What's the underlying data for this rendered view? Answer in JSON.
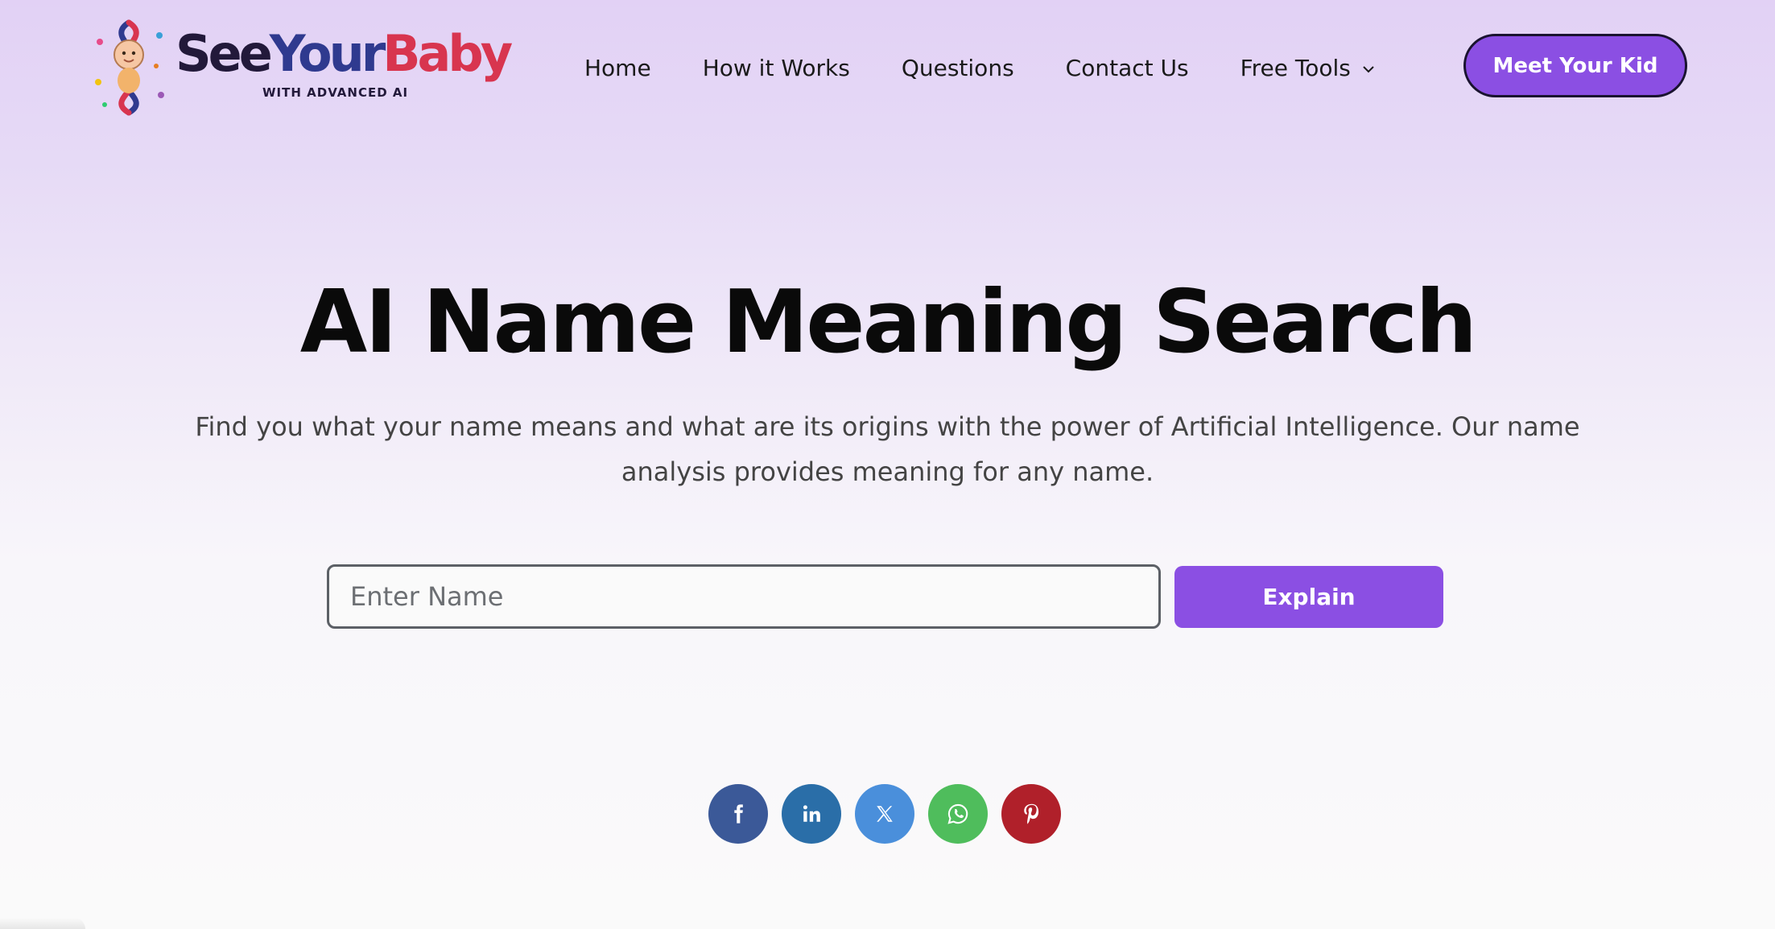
{
  "brand": {
    "word_see": "See",
    "word_your": "Your",
    "word_baby": "Baby",
    "tagline": "WITH ADVANCED AI"
  },
  "nav": {
    "items": [
      {
        "label": "Home"
      },
      {
        "label": "How it Works"
      },
      {
        "label": "Questions"
      },
      {
        "label": "Contact Us"
      },
      {
        "label": "Free Tools",
        "icon": "chevron-down-icon"
      }
    ]
  },
  "cta": {
    "label": "Meet Your Kid"
  },
  "hero": {
    "title": "AI Name Meaning Search",
    "subtitle": "Find you what your name means and what are its origins with the power of Artificial Intelligence. Our name analysis provides meaning for any name."
  },
  "search": {
    "placeholder": "Enter Name",
    "value": "",
    "button_label": "Explain"
  },
  "share": [
    {
      "network": "facebook",
      "icon": "facebook-icon",
      "color": "#3b5998"
    },
    {
      "network": "linkedin",
      "icon": "linkedin-icon",
      "color": "#2a6ea8"
    },
    {
      "network": "x",
      "icon": "x-icon",
      "color": "#4a8fdb"
    },
    {
      "network": "whatsapp",
      "icon": "whatsapp-icon",
      "color": "#4fbd5c"
    },
    {
      "network": "pinterest",
      "icon": "pinterest-icon",
      "color": "#b0202a"
    }
  ],
  "colors": {
    "accent": "#8b4fe3",
    "cta_border": "#1a1330",
    "brand_dark": "#22193a",
    "brand_blue": "#2f3a8f",
    "brand_red": "#d8354f"
  }
}
